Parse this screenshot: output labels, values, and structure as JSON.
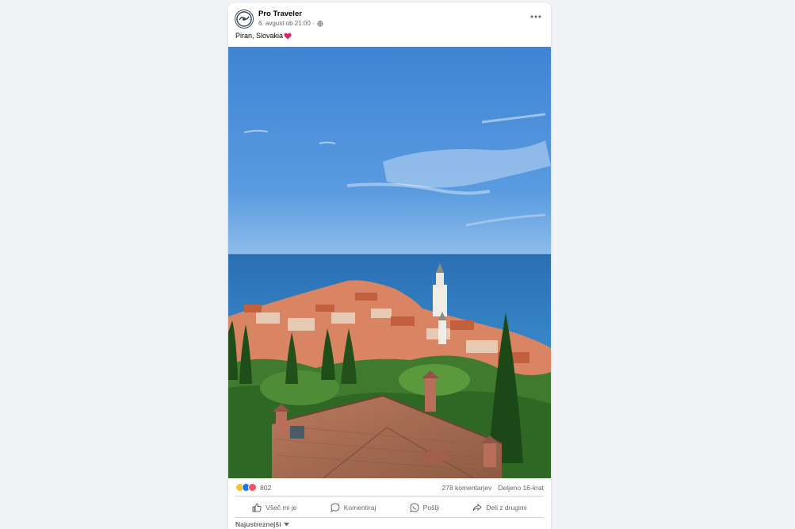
{
  "post": {
    "page_name": "Pro Traveler",
    "timestamp": "6. avgust ob 21:00 ·",
    "caption": "Piran, Slovakia",
    "avatar_icon": "pro-traveler-logo",
    "more_icon": "ellipsis-icon",
    "audience_icon": "globe-icon",
    "caption_emoji": "red-heart-icon"
  },
  "photo": {
    "alt": "Piran, Slovakia"
  },
  "stats": {
    "reaction_icons": [
      "haha-icon",
      "like-icon",
      "angry-icon"
    ],
    "reaction_count": "802",
    "comments": "278 komentarjev",
    "shares": "Deljeno 16-krat"
  },
  "actions": {
    "like": "Všeč mi je",
    "comment": "Komentiraj",
    "send": "Pošlji",
    "share": "Deli z drugimi"
  },
  "comments": {
    "sort_label": "Najustreznejši"
  },
  "colors": {
    "background": "#f0f2f5",
    "card": "#ffffff",
    "text_secondary": "#65676b",
    "like_blue": "#1877f2",
    "sky": "#4f8fd6",
    "sea": "#2f7bbf",
    "roof": "#c96f4c"
  }
}
